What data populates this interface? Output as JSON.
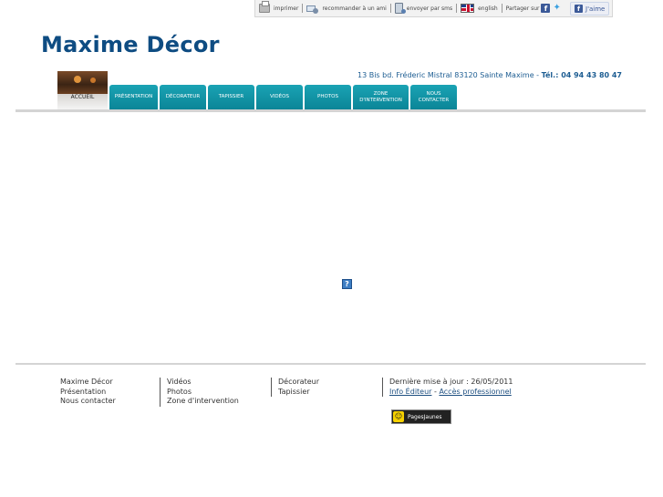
{
  "toolbar": {
    "print": "imprimer",
    "recommend": "recommander à un ami",
    "sms": "envoyer par sms",
    "english": "english",
    "share": "Partager sur",
    "like": "J'aime"
  },
  "header": {
    "title": "Maxime Décor",
    "address": "13 Bis bd. Fréderic Mistral 83120 Sainte Maxime",
    "separator": "-",
    "tel_label": "Tél.: 04 94 43 80 47"
  },
  "nav": {
    "items": [
      {
        "label": "ACCUEIL"
      },
      {
        "label": "PRÉSENTATION"
      },
      {
        "label": "DÉCORATEUR"
      },
      {
        "label": "TAPISSIER"
      },
      {
        "label": "VIDÉOS"
      },
      {
        "label": "PHOTOS"
      },
      {
        "label": "ZONE D'INTERVENTION"
      },
      {
        "label": "NOUS CONTACTER"
      }
    ]
  },
  "content": {
    "placeholder_glyph": "?"
  },
  "footer": {
    "col1": [
      "Maxime Décor",
      "Présentation",
      "Nous contacter"
    ],
    "col2": [
      "Vidéos",
      "Photos",
      "Zone d'intervention"
    ],
    "col3": [
      "Décorateur",
      "Tapissier"
    ],
    "updated": "Dernière mise à jour : 26/05/2011",
    "info_editeur": "Info Éditeur",
    "dash": "-",
    "acces_pro": "Accès professionnel",
    "pages_jaunes": "PagesJaunes"
  },
  "colors": {
    "title": "#0e4c82",
    "nav_tab": "#0b8597",
    "link": "#1d4f80"
  }
}
